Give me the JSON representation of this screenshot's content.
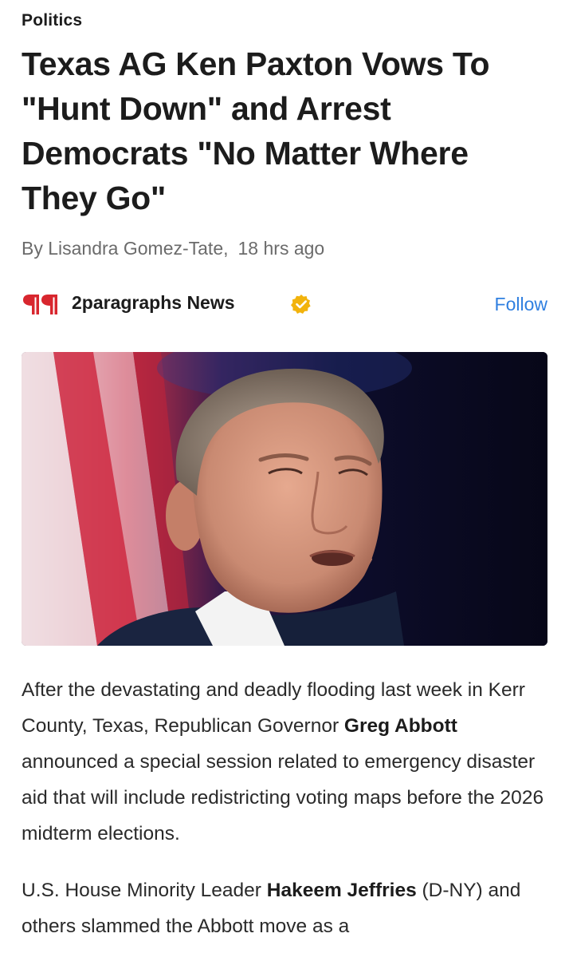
{
  "article": {
    "category": "Politics",
    "headline": "Texas AG Ken Paxton Vows To \"Hunt Down\" and Arrest Democrats \"No Matter Where They Go\"",
    "byline": {
      "author": "By Lisandra Gomez-Tate,",
      "time": "18 hrs ago"
    },
    "publisher": {
      "name": "2paragraphs News",
      "follow_label": "Follow",
      "logo_icon": "double-pilcrow-logo",
      "verified_icon": "verified-badge-icon",
      "logo_color": "#d8262e",
      "verified_color": "#f2b30c"
    },
    "image": {
      "alt_icon": "speaker-photo"
    },
    "paragraphs": [
      {
        "t1": "After the devastating and deadly flooding last week in Kerr County, Texas, Republican Governor ",
        "b1": "Greg Abbott",
        "t2": " announced a special session related to emergency disaster aid that will include redistricting voting maps before the 2026 midterm elections."
      },
      {
        "t1": "U.S. House Minority Leader ",
        "b1": "Hakeem Jeffries",
        "t2": " (D-NY) and others slammed the Abbott move as a"
      }
    ]
  },
  "colors": {
    "link": "#2f7fe0",
    "text": "#1c1c1c",
    "muted": "#6b6b6b"
  }
}
